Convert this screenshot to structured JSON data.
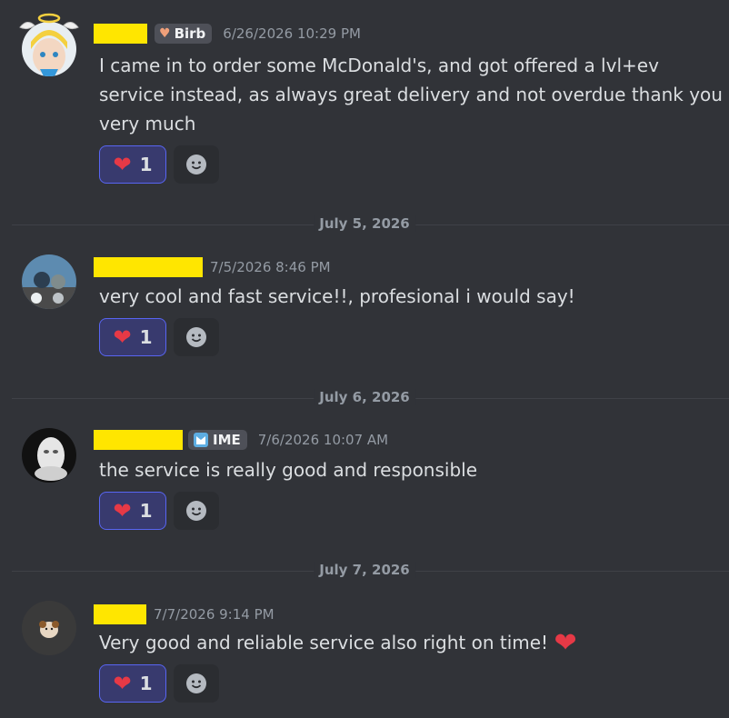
{
  "messages": [
    {
      "badge": "Birb",
      "badge_icon": "heart-badge-icon",
      "timestamp": "6/26/2026 10:29 PM",
      "text": "I came in to order some McDonald's, and got offered a lvl+ev service instead, as always great delivery and not overdue thank you very much",
      "reaction_count": "1"
    },
    {
      "timestamp": "7/5/2026 8:46 PM",
      "text": "very cool and fast service!!, profesional i would say!",
      "reaction_count": "1"
    },
    {
      "badge": "IME",
      "badge_icon": "guild-tag-icon",
      "timestamp": "7/6/2026 10:07 AM",
      "text": "the service is really good and responsible",
      "reaction_count": "1"
    },
    {
      "timestamp": "7/7/2026 9:14 PM",
      "text": "Very good and reliable service also right on time!",
      "reaction_count": "1"
    }
  ],
  "dividers": [
    "July 5, 2026",
    "July 6, 2026",
    "July 7, 2026"
  ],
  "colors": {
    "background": "#313338",
    "redaction": "#ffe600",
    "reaction_border": "#5865f2",
    "heart": "#e63946"
  }
}
